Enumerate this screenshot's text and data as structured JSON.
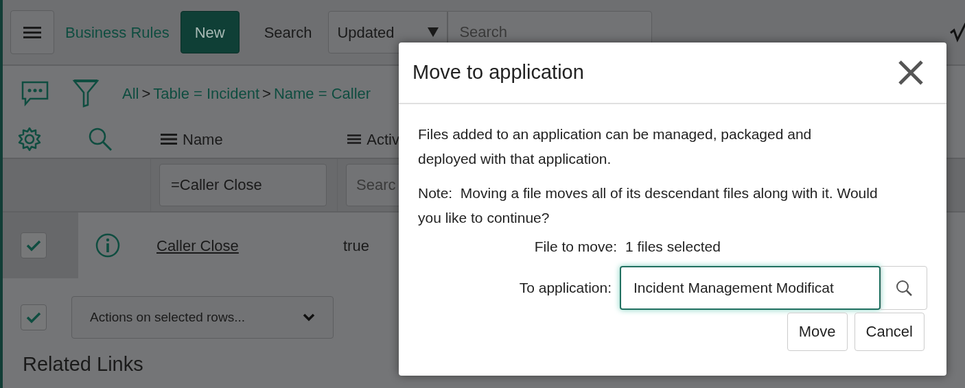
{
  "header": {
    "title": "Business Rules",
    "new_button": "New",
    "search_label": "Search",
    "search_select": "Updated",
    "search_placeholder": "Search"
  },
  "breadcrumb": [
    {
      "text": "All",
      "kind": "link"
    },
    {
      "text": ">",
      "kind": "separator"
    },
    {
      "text": "Table = Incident",
      "kind": "link"
    },
    {
      "text": ">",
      "kind": "separator"
    },
    {
      "text": "Name = Caller",
      "kind": "link"
    }
  ],
  "columns": [
    {
      "label": "Name",
      "filter": "=Caller Close"
    },
    {
      "label": "Activ",
      "placeholder": "Searc"
    }
  ],
  "rows": [
    {
      "checked": true,
      "name": "Caller Close",
      "active": "true"
    }
  ],
  "select_all": {
    "checked": true
  },
  "actions_select": "Actions on selected rows...",
  "related_links": "Related Links",
  "dialog": {
    "title": "Move to application",
    "paragraph": "Files added to an application can be managed, packaged and deployed with that application.",
    "note": "Note:  Moving a file moves all of its descendant files along with it. Would you like to continue?",
    "fields": [
      {
        "label": "File to move:",
        "value": "1 files selected",
        "kind": "text"
      },
      {
        "label": "To application:",
        "value": "Incident Management Modificat",
        "kind": "input"
      }
    ],
    "buttons": [
      "Move",
      "Cancel"
    ]
  }
}
